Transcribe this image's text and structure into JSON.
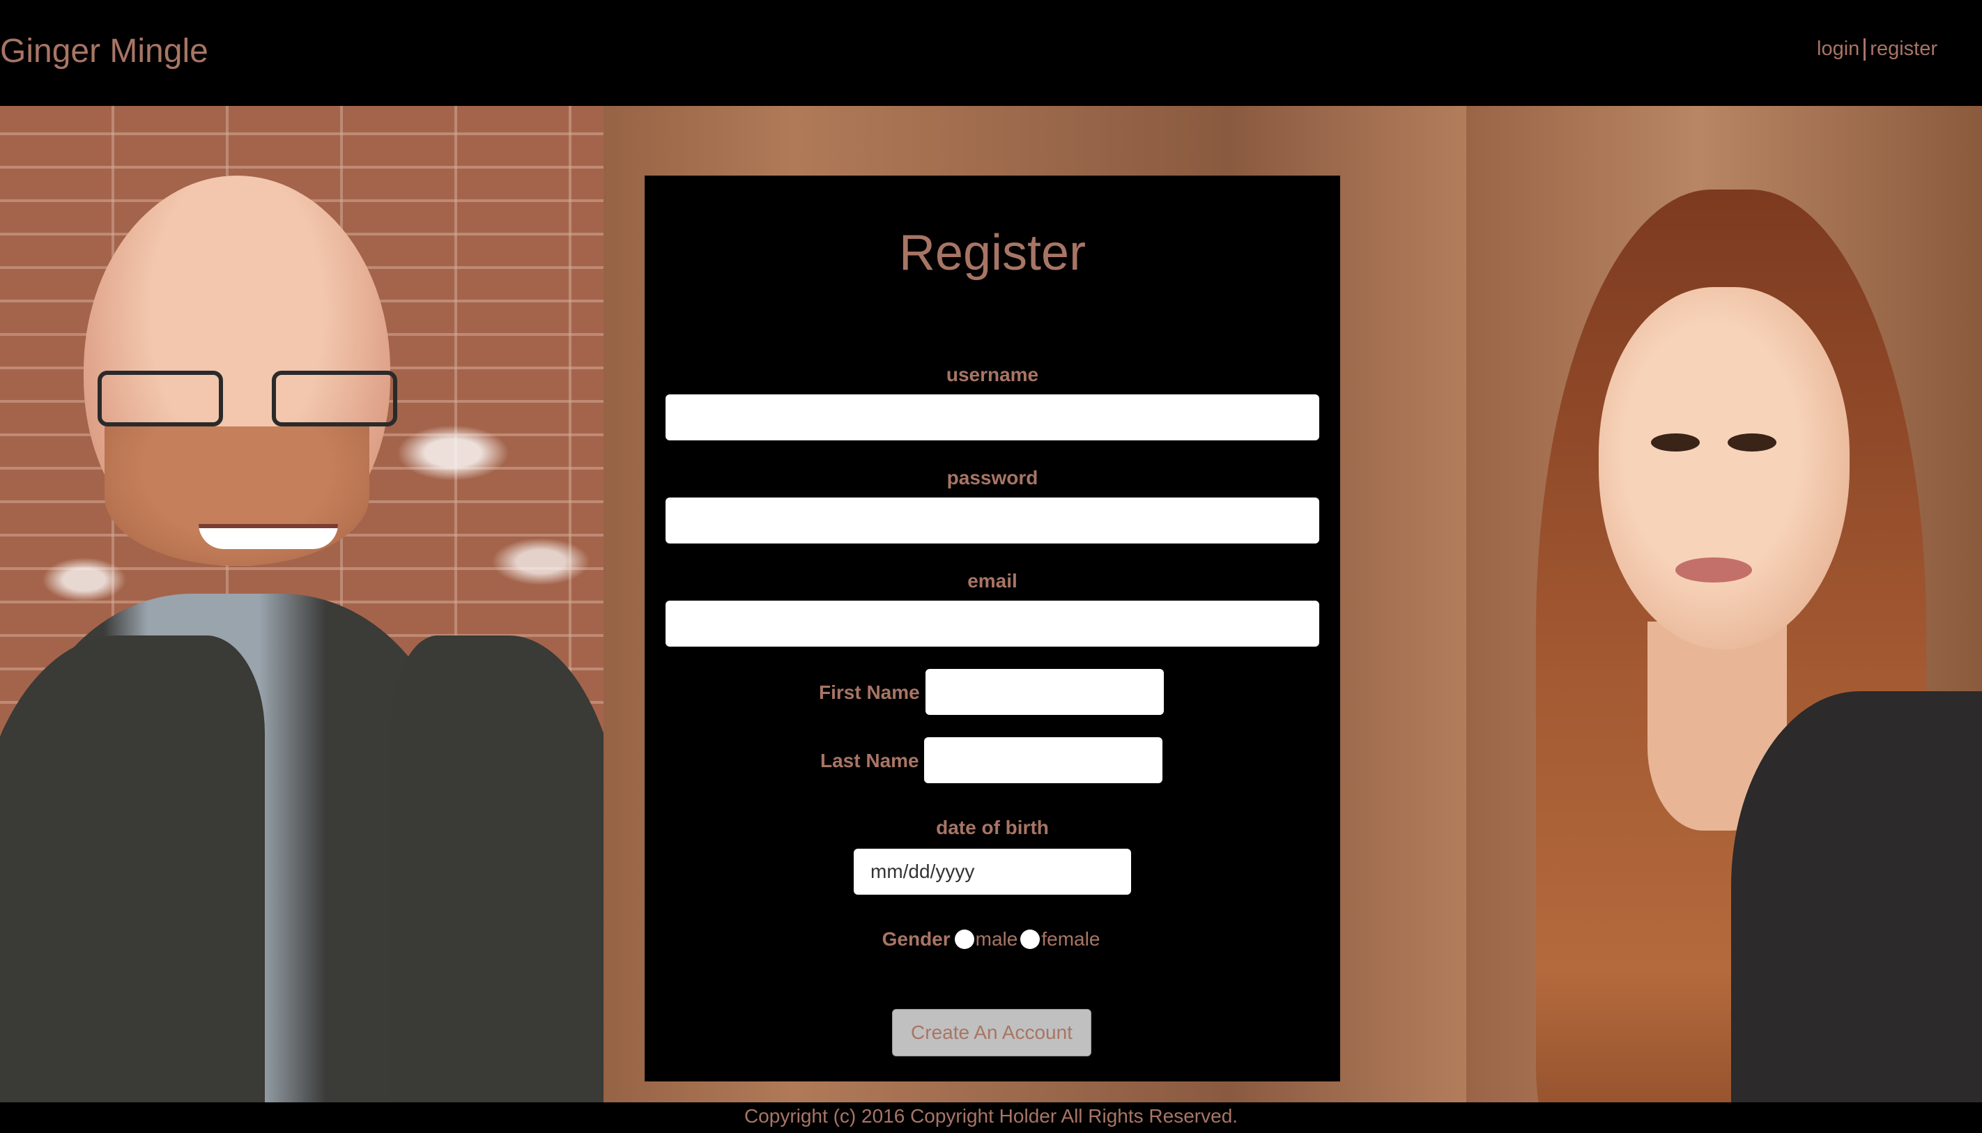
{
  "header": {
    "brand": "Ginger Mingle",
    "nav": {
      "login": "login",
      "register": "register"
    }
  },
  "form": {
    "title": "Register",
    "username_label": "username",
    "password_label": "password",
    "email_label": "email",
    "first_name_label": "First Name",
    "last_name_label": "Last Name",
    "dob_label": "date of birth",
    "dob_placeholder": "mm/dd/yyyy",
    "gender_label": "Gender",
    "gender_options": [
      "male",
      "female"
    ],
    "submit_label": "Create An Account"
  },
  "footer": {
    "text": "Copyright (c) 2016 Copyright Holder All Rights Reserved."
  },
  "colors": {
    "accent": "#a87565",
    "panel": "#000000",
    "background": "#8a5a3e"
  }
}
